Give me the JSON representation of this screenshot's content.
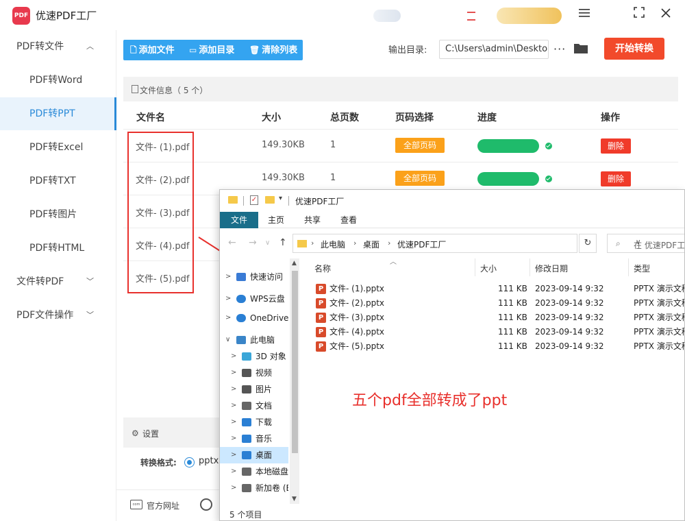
{
  "app": {
    "title": "优速PDF工厂",
    "logo_text": "PDF"
  },
  "window_controls": {
    "menu_icon": "menu-icon",
    "maximize_icon": "maximize-icon",
    "close_icon": "close-icon"
  },
  "sidebar": {
    "items": [
      {
        "label": "PDF转文件",
        "type": "parent",
        "expanded": true
      },
      {
        "label": "PDF转Word",
        "type": "child"
      },
      {
        "label": "PDF转PPT",
        "type": "child",
        "active": true
      },
      {
        "label": "PDF转Excel",
        "type": "child"
      },
      {
        "label": "PDF转TXT",
        "type": "child"
      },
      {
        "label": "PDF转图片",
        "type": "child"
      },
      {
        "label": "PDF转HTML",
        "type": "child"
      },
      {
        "label": "文件转PDF",
        "type": "parent",
        "expanded": false
      },
      {
        "label": "PDF文件操作",
        "type": "parent",
        "expanded": false
      }
    ]
  },
  "toolbar": {
    "add_file": "添加文件",
    "add_dir": "添加目录",
    "clear_list": "清除列表",
    "output_label": "输出目录:",
    "output_path": "C:\\Users\\admin\\Deskto",
    "more": "···",
    "start": "开始转换"
  },
  "file_list": {
    "info": "文件信息（ 5 个）",
    "headers": {
      "name": "文件名",
      "size": "大小",
      "pages": "总页数",
      "page_select": "页码选择",
      "progress": "进度",
      "action": "操作"
    },
    "rows": [
      {
        "name": "文件- (1).pdf",
        "size": "149.30KB",
        "pages": "1",
        "page_select": "全部页码",
        "progress": 1.0,
        "action": "删除"
      },
      {
        "name": "文件- (2).pdf",
        "size": "149.30KB",
        "pages": "1",
        "page_select": "全部页码",
        "progress": 1.0,
        "action": "删除"
      },
      {
        "name": "文件- (3).pdf"
      },
      {
        "name": "文件- (4).pdf"
      },
      {
        "name": "文件- (5).pdf"
      }
    ]
  },
  "settings": {
    "title": "设置",
    "format_label": "转换格式:",
    "format_value": "pptx"
  },
  "footer": {
    "site_label": "官方网址",
    "site_icon_text": "com"
  },
  "explorer": {
    "title": "优速PDF工厂",
    "ribbon": [
      "文件",
      "主页",
      "共享",
      "查看"
    ],
    "breadcrumb": [
      "此电脑",
      "桌面",
      "优速PDF工厂"
    ],
    "search_placeholder": "在 优速PDF工厂",
    "nav": [
      {
        "label": "快速访问",
        "icon": "star-icon",
        "level": 0
      },
      {
        "label": "WPS云盘",
        "icon": "cloud-icon",
        "level": 0
      },
      {
        "label": "OneDrive",
        "icon": "cloud-icon",
        "level": 0
      },
      {
        "label": "此电脑",
        "icon": "computer-icon",
        "level": 0,
        "expanded": true
      },
      {
        "label": "3D 对象",
        "icon": "cube-icon",
        "level": 1
      },
      {
        "label": "视频",
        "icon": "video-icon",
        "level": 1
      },
      {
        "label": "图片",
        "icon": "image-icon",
        "level": 1
      },
      {
        "label": "文档",
        "icon": "document-icon",
        "level": 1
      },
      {
        "label": "下载",
        "icon": "download-icon",
        "level": 1
      },
      {
        "label": "音乐",
        "icon": "music-icon",
        "level": 1
      },
      {
        "label": "桌面",
        "icon": "desktop-icon",
        "level": 1,
        "selected": true
      },
      {
        "label": "本地磁盘",
        "icon": "drive-icon",
        "level": 1
      },
      {
        "label": "新加卷 (E",
        "icon": "drive-icon",
        "level": 1
      }
    ],
    "columns": {
      "name": "名称",
      "size": "大小",
      "date": "修改日期",
      "type": "类型"
    },
    "files": [
      {
        "icon_letter": "P",
        "name": "文件- (1).pptx",
        "size": "111 KB",
        "date": "2023-09-14 9:32",
        "type": "PPTX 演示文稿"
      },
      {
        "icon_letter": "P",
        "name": "文件- (2).pptx",
        "size": "111 KB",
        "date": "2023-09-14 9:32",
        "type": "PPTX 演示文稿"
      },
      {
        "icon_letter": "P",
        "name": "文件- (3).pptx",
        "size": "111 KB",
        "date": "2023-09-14 9:32",
        "type": "PPTX 演示文稿"
      },
      {
        "icon_letter": "P",
        "name": "文件- (4).pptx",
        "size": "111 KB",
        "date": "2023-09-14 9:32",
        "type": "PPTX 演示文稿"
      },
      {
        "icon_letter": "P",
        "name": "文件- (5).pptx",
        "size": "111 KB",
        "date": "2023-09-14 9:32",
        "type": "PPTX 演示文稿"
      }
    ],
    "status": "5 个项目"
  },
  "annotation": "五个pdf全部转成了ppt",
  "colors": {
    "accent": "#2a8ad8",
    "toolbar": "#34a4f0",
    "start": "#f24a2b",
    "progress": "#1fbb6b",
    "page_btn": "#fba11a",
    "delete": "#f03b2a",
    "annotation": "#e8302c"
  }
}
